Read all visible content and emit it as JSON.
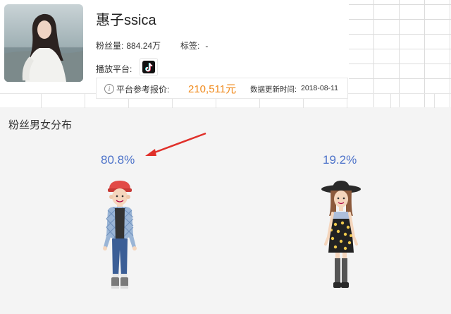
{
  "profile": {
    "name": "惠子ssica",
    "fans_label": "粉丝量:",
    "fans_value": "884.24万",
    "tag_label": "标签:",
    "tag_value": "-",
    "platform_label": "播放平台:",
    "platform_icon": "tiktok-icon"
  },
  "price": {
    "info_icon": "i",
    "label": "平台参考报价:",
    "value": "210,511元",
    "update_label": "数据更新时间:",
    "update_value": "2018-08-11",
    "value_color": "#f08a1c"
  },
  "gender": {
    "title": "粉丝男女分布",
    "male_percent": "80.8%",
    "female_percent": "19.2%",
    "percent_color": "#4c72c9",
    "annotation_color": "#e0302a"
  }
}
